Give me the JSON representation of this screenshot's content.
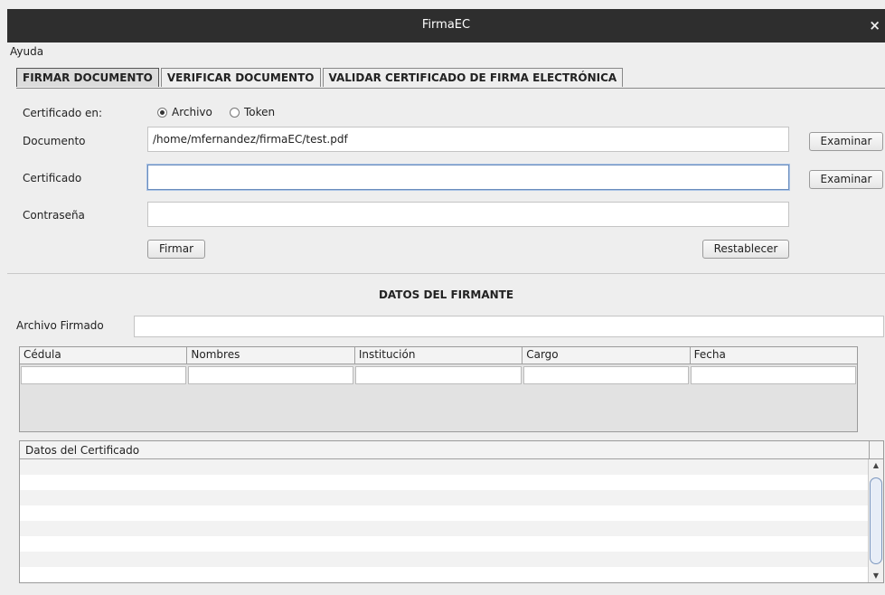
{
  "window": {
    "title": "FirmaEC",
    "close_glyph": "×"
  },
  "menu": {
    "items": [
      "Ayuda"
    ]
  },
  "tabs": [
    {
      "label": "FIRMAR DOCUMENTO",
      "active": true
    },
    {
      "label": "VERIFICAR DOCUMENTO",
      "active": false
    },
    {
      "label": "VALIDAR CERTIFICADO DE FIRMA ELECTRÓNICA",
      "active": false
    }
  ],
  "form": {
    "cert_in_label": "Certificado en:",
    "radio_archivo": "Archivo",
    "radio_token": "Token",
    "selected_radio": "Archivo",
    "document_label": "Documento",
    "document_value": "/home/mfernandez/firmaEC/test.pdf",
    "certificate_label": "Certificado",
    "certificate_value": "",
    "password_label": "Contraseña",
    "password_value": "",
    "examinar_label": "Examinar",
    "firmar_label": "Firmar",
    "restablecer_label": "Restablecer"
  },
  "firmante": {
    "section_title": "DATOS DEL FIRMANTE",
    "archivo_label": "Archivo Firmado",
    "archivo_value": "",
    "columns": [
      "Cédula",
      "Nombres",
      "Institución",
      "Cargo",
      "Fecha"
    ]
  },
  "certificado": {
    "header": "Datos del Certificado"
  }
}
